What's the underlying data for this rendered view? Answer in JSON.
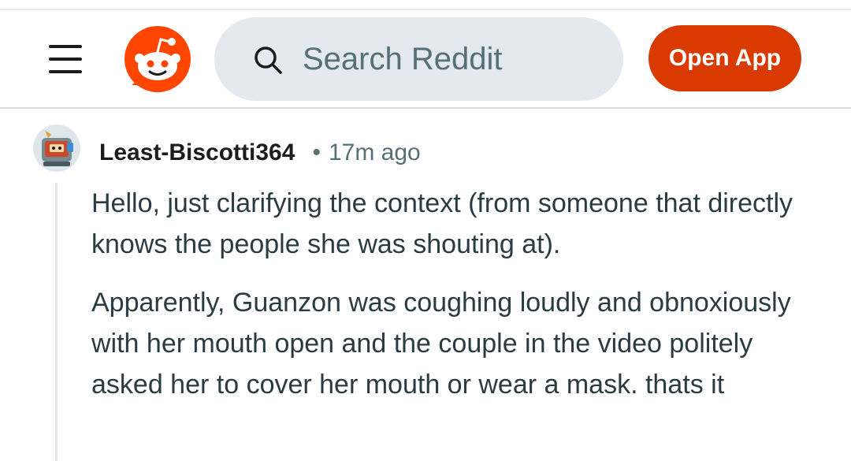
{
  "header": {
    "menu_icon": "hamburger-menu-icon",
    "logo_icon": "reddit-snoo-logo",
    "search": {
      "placeholder": "Search Reddit",
      "icon": "search-icon"
    },
    "open_app_label": "Open App"
  },
  "comment": {
    "author": "Least-Biscotti364",
    "separator": "•",
    "time_ago": "17m ago",
    "paragraphs": [
      "Hello, just clarifying the context (from someone that directly knows the people she was shouting at).",
      "Apparently, Guanzon was coughing loudly and obnoxiously with her mouth open and the couple in the video politely asked her to cover her mouth or wear a mask. thats it"
    ]
  },
  "colors": {
    "brand_orange": "#FF4500",
    "open_app_bg": "#D93A00",
    "search_bg": "#E3E9EE",
    "muted_text": "#576F76",
    "body_text": "#2A3C42"
  }
}
